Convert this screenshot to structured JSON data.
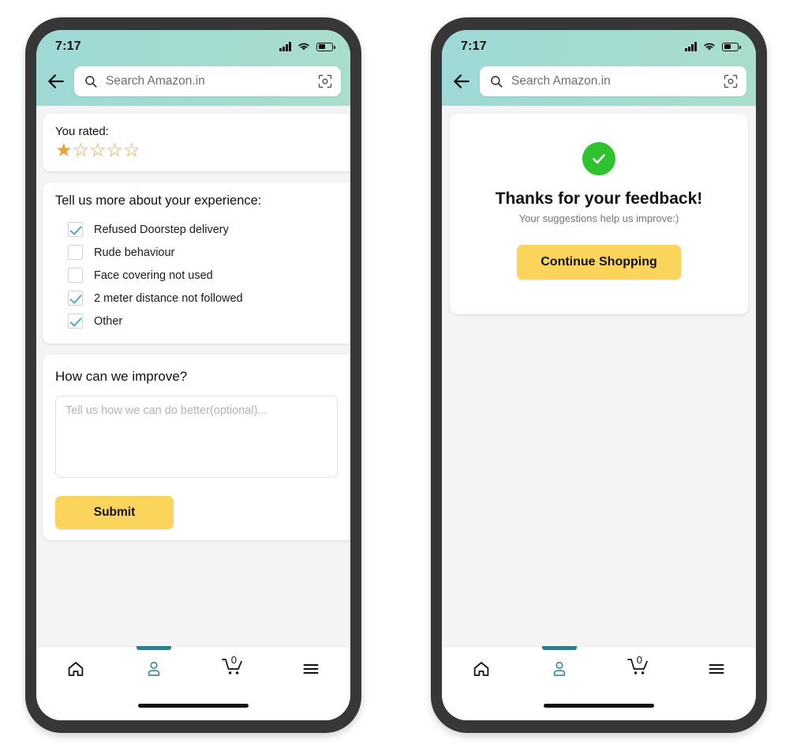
{
  "status_bar": {
    "time": "7:17",
    "signal_icon": "signal-bars-icon",
    "wifi_icon": "wifi-icon",
    "battery_icon": "battery-icon"
  },
  "header": {
    "back_icon": "back-arrow-icon",
    "search_icon": "search-icon",
    "search_placeholder": "Search Amazon.in",
    "search_value": "",
    "camera_icon": "camera-lens-icon",
    "gradient_from": "#9ed9d6",
    "gradient_to": "#a9ddcc"
  },
  "left_phone": {
    "rating_card": {
      "label": "You rated:",
      "rating": 1,
      "max_rating": 5,
      "star_color": "#e8a33d",
      "filled_star_glyph": "★",
      "empty_star_glyph": "☆"
    },
    "experience_card": {
      "title": "Tell us more about your experience:",
      "options": [
        {
          "label": "Refused Doorstep delivery",
          "checked": true
        },
        {
          "label": "Rude behaviour",
          "checked": false
        },
        {
          "label": "Face covering not used",
          "checked": false
        },
        {
          "label": "2 meter distance not followed",
          "checked": true
        },
        {
          "label": "Other",
          "checked": true
        }
      ],
      "check_color": "#57a9c4"
    },
    "improve_card": {
      "title": "How can we improve?",
      "textarea_placeholder": "Tell us how we can do better(optional)...",
      "textarea_value": "",
      "submit_label": "Submit",
      "submit_color": "#fbd45c"
    }
  },
  "right_phone": {
    "thanks_card": {
      "success_icon": "check-circle-icon",
      "success_color": "#2ec32e",
      "title": "Thanks for your feedback!",
      "subtitle": "Your suggestions help us improve:)",
      "button_label": "Continue Shopping",
      "button_color": "#fbd45c"
    }
  },
  "bottom_nav": {
    "active_index": 1,
    "active_color": "#2d7d8c",
    "items": [
      {
        "name": "home",
        "icon": "home-icon",
        "label": ""
      },
      {
        "name": "account",
        "icon": "person-icon",
        "label": ""
      },
      {
        "name": "cart",
        "icon": "cart-icon",
        "label": "",
        "badge": "0"
      },
      {
        "name": "menu",
        "icon": "hamburger-menu-icon",
        "label": ""
      }
    ]
  }
}
